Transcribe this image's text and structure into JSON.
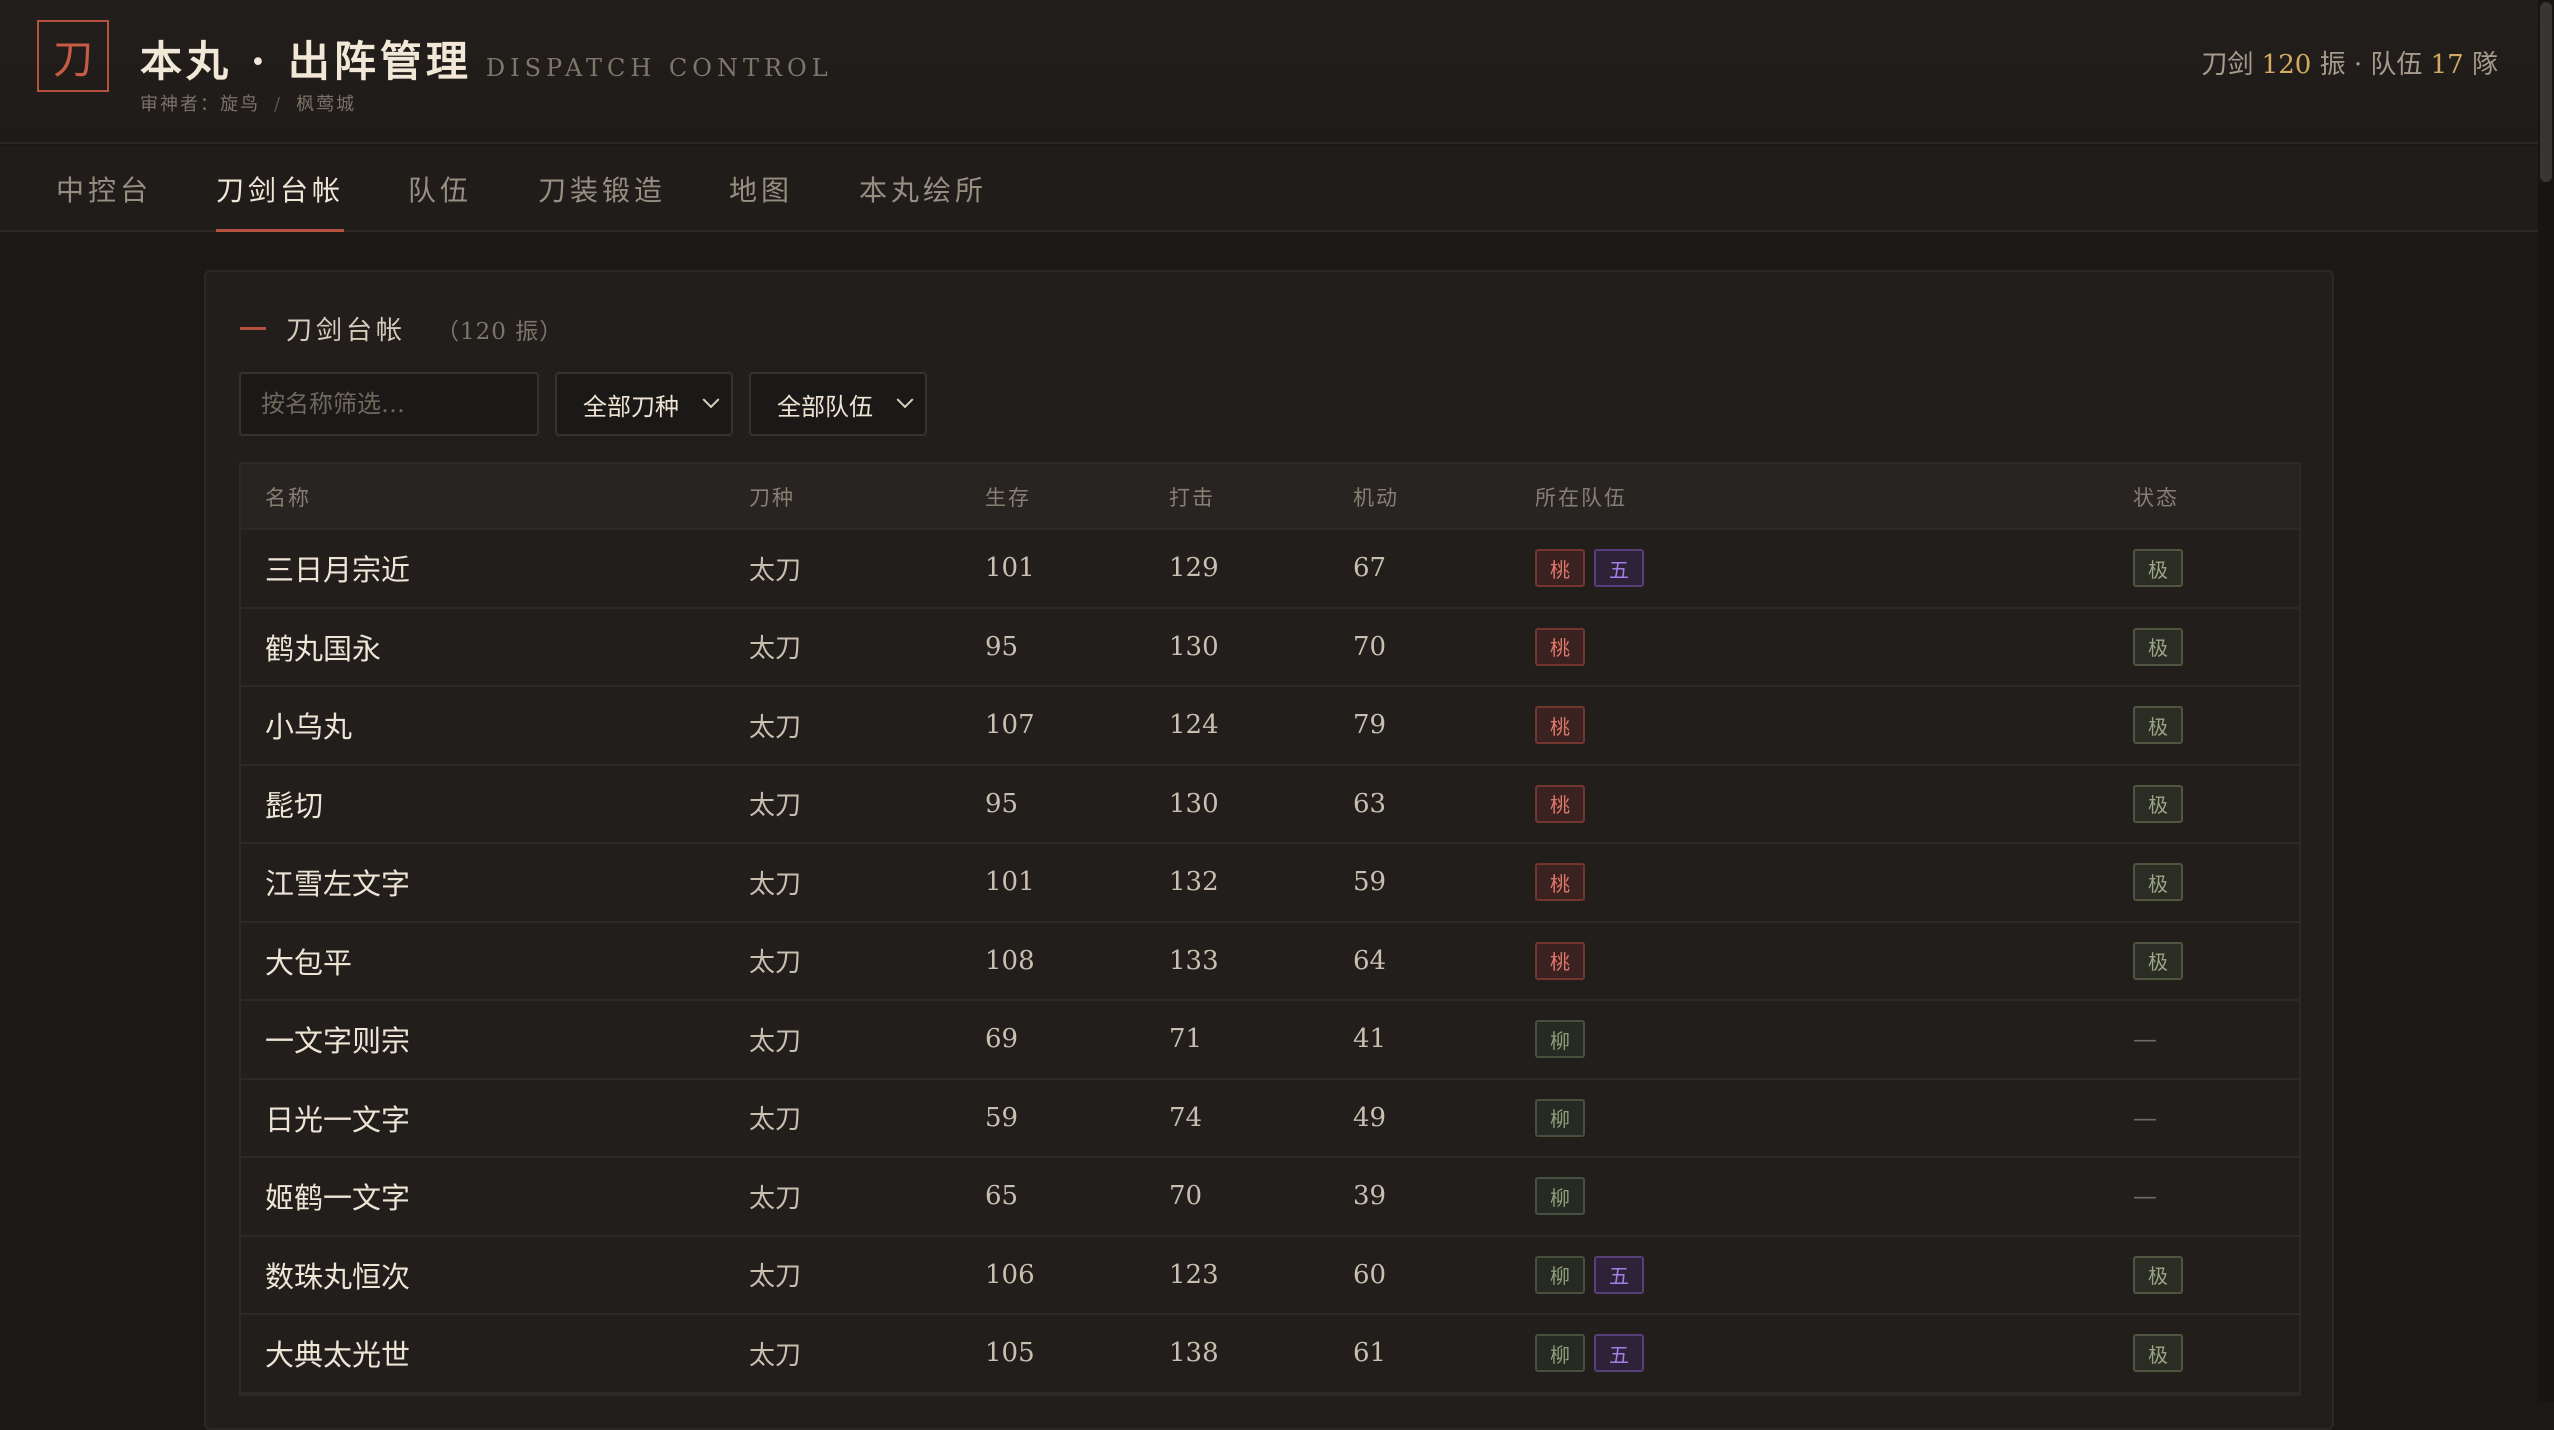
{
  "header": {
    "logo_char": "刀",
    "title": "本丸 · 出阵管理",
    "subtitle": "DISPATCH CONTROL",
    "saniwa": "审神者：旋鸟",
    "separator": "/",
    "castle": "枫莺城",
    "counts": {
      "swords_prefix": "刀剑",
      "swords_num": "120",
      "swords_suffix": "振 · 队伍",
      "teams_num": "17",
      "teams_suffix": "隊"
    }
  },
  "nav": {
    "tabs": [
      {
        "label": "中控台",
        "active": false
      },
      {
        "label": "刀剑台帐",
        "active": true
      },
      {
        "label": "队伍",
        "active": false
      },
      {
        "label": "刀装锻造",
        "active": false
      },
      {
        "label": "地图",
        "active": false
      },
      {
        "label": "本丸绘所",
        "active": false
      }
    ]
  },
  "panel": {
    "title": "刀剑台帐",
    "count": "（120 振）",
    "filters": {
      "search_placeholder": "按名称筛选…",
      "type_select": "全部刀种",
      "team_select": "全部队伍"
    },
    "columns": {
      "name": "名称",
      "type": "刀种",
      "hp": "生存",
      "atk": "打击",
      "mob": "机动",
      "team": "所在队伍",
      "status": "状态"
    },
    "rows": [
      {
        "name": "三日月宗近",
        "type": "太刀",
        "hp": "101",
        "atk": "129",
        "mob": "67",
        "teams": [
          {
            "label": "桃",
            "kind": "peach"
          },
          {
            "label": "五",
            "kind": "five"
          }
        ],
        "status": "极"
      },
      {
        "name": "鹤丸国永",
        "type": "太刀",
        "hp": "95",
        "atk": "130",
        "mob": "70",
        "teams": [
          {
            "label": "桃",
            "kind": "peach"
          }
        ],
        "status": "极"
      },
      {
        "name": "小乌丸",
        "type": "太刀",
        "hp": "107",
        "atk": "124",
        "mob": "79",
        "teams": [
          {
            "label": "桃",
            "kind": "peach"
          }
        ],
        "status": "极"
      },
      {
        "name": "髭切",
        "type": "太刀",
        "hp": "95",
        "atk": "130",
        "mob": "63",
        "teams": [
          {
            "label": "桃",
            "kind": "peach"
          }
        ],
        "status": "极"
      },
      {
        "name": "江雪左文字",
        "type": "太刀",
        "hp": "101",
        "atk": "132",
        "mob": "59",
        "teams": [
          {
            "label": "桃",
            "kind": "peach"
          }
        ],
        "status": "极"
      },
      {
        "name": "大包平",
        "type": "太刀",
        "hp": "108",
        "atk": "133",
        "mob": "64",
        "teams": [
          {
            "label": "桃",
            "kind": "peach"
          }
        ],
        "status": "极"
      },
      {
        "name": "一文字则宗",
        "type": "太刀",
        "hp": "69",
        "atk": "71",
        "mob": "41",
        "teams": [
          {
            "label": "柳",
            "kind": "willow"
          }
        ],
        "status": "—"
      },
      {
        "name": "日光一文字",
        "type": "太刀",
        "hp": "59",
        "atk": "74",
        "mob": "49",
        "teams": [
          {
            "label": "柳",
            "kind": "willow"
          }
        ],
        "status": "—"
      },
      {
        "name": "姬鹤一文字",
        "type": "太刀",
        "hp": "65",
        "atk": "70",
        "mob": "39",
        "teams": [
          {
            "label": "柳",
            "kind": "willow"
          }
        ],
        "status": "—"
      },
      {
        "name": "数珠丸恒次",
        "type": "太刀",
        "hp": "106",
        "atk": "123",
        "mob": "60",
        "teams": [
          {
            "label": "柳",
            "kind": "willow"
          },
          {
            "label": "五",
            "kind": "five"
          }
        ],
        "status": "极"
      },
      {
        "name": "大典太光世",
        "type": "太刀",
        "hp": "105",
        "atk": "138",
        "mob": "61",
        "teams": [
          {
            "label": "柳",
            "kind": "willow"
          },
          {
            "label": "五",
            "kind": "five"
          }
        ],
        "status": "极"
      }
    ]
  }
}
